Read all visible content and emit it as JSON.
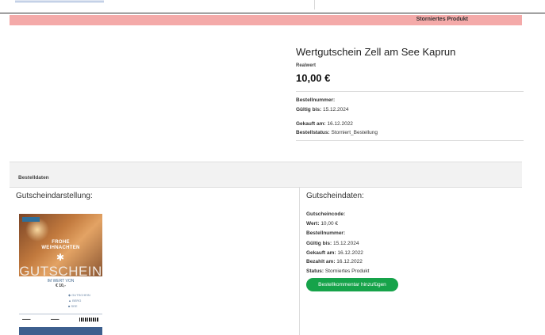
{
  "banner": {
    "status_label": "Storniertes Produkt"
  },
  "product": {
    "title": "Wertgutschein Zell am See Kaprun",
    "price_label": "Realwert",
    "price": "10,00 €",
    "order_number_label": "Bestellnummer:",
    "order_number_value": "",
    "valid_until_label": "Gültig bis:",
    "valid_until_value": "15.12.2024",
    "bought_label": "Gekauft am:",
    "bought_value": "16.12.2022",
    "order_status_label": "Bestellstatus:",
    "order_status_value": "Storniert_Bestellung"
  },
  "section": {
    "title": "Bestelldaten"
  },
  "left": {
    "heading": "Gutscheindarstellung:"
  },
  "right": {
    "heading": "Gutscheindaten:",
    "details": [
      {
        "label": "Gutscheincode:",
        "value": ""
      },
      {
        "label": "Wert:",
        "value": "10,00 €"
      },
      {
        "label": "Bestellnummer:",
        "value": ""
      },
      {
        "label": "Gültig bis:",
        "value": "15.12.2024"
      },
      {
        "label": "Gekauft am:",
        "value": "16.12.2022"
      },
      {
        "label": "Bezahlt am:",
        "value": "16.12.2022"
      },
      {
        "label": "Status:",
        "value": "Storniertes Produkt"
      }
    ],
    "comment_button": "Bestellkommentar hinzufügen"
  },
  "voucher": {
    "greeting_top": "FROHE",
    "greeting_bottom": "WEIHNACHTEN",
    "word": "GUTSCHEIN",
    "value_label": "IM WERT VON",
    "amount": "€ 10,-",
    "features": [
      "GUTSCHEIN",
      "BERG",
      "SEE"
    ]
  },
  "colors": {
    "banner": "#f4aaa9",
    "button": "#16a34a"
  }
}
